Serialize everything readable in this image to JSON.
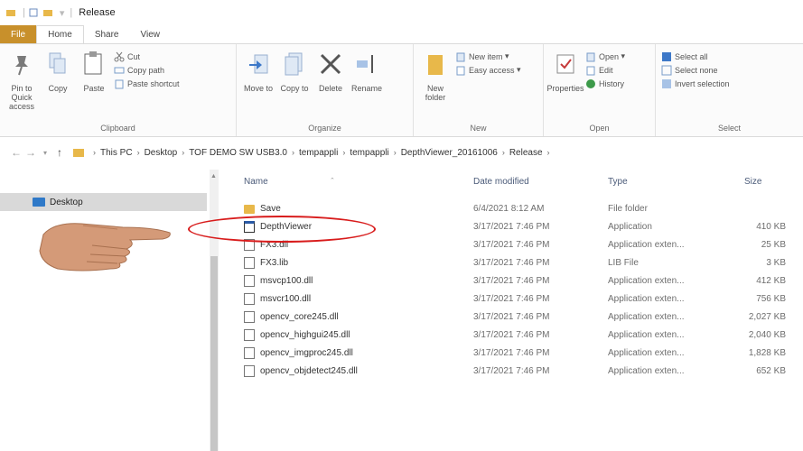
{
  "window": {
    "title": "Release"
  },
  "tabs": [
    {
      "label": "File"
    },
    {
      "label": "Home"
    },
    {
      "label": "Share"
    },
    {
      "label": "View"
    }
  ],
  "ribbon": {
    "clipboard": {
      "label": "Clipboard",
      "pin": "Pin to Quick access",
      "copy": "Copy",
      "paste": "Paste",
      "cut": "Cut",
      "copy_path": "Copy path",
      "paste_shortcut": "Paste shortcut"
    },
    "organize": {
      "label": "Organize",
      "move_to": "Move to",
      "copy_to": "Copy to",
      "delete": "Delete",
      "rename": "Rename"
    },
    "new": {
      "label": "New",
      "new_folder": "New folder",
      "new_item": "New item",
      "easy_access": "Easy access"
    },
    "open": {
      "label": "Open",
      "properties": "Properties",
      "open": "Open",
      "edit": "Edit",
      "history": "History"
    },
    "select": {
      "label": "Select",
      "select_all": "Select all",
      "select_none": "Select none",
      "invert_selection": "Invert selection"
    }
  },
  "address": {
    "crumbs": [
      "This PC",
      "Desktop",
      "TOF DEMO SW USB3.0",
      "tempappli",
      "tempappli",
      "DepthViewer_20161006",
      "Release"
    ]
  },
  "navpane": {
    "desktop": "Desktop"
  },
  "columns": {
    "name": "Name",
    "date": "Date modified",
    "type": "Type",
    "size": "Size"
  },
  "files": [
    {
      "name": "Save",
      "date": "6/4/2021 8:12 AM",
      "type": "File folder",
      "size": "",
      "icon": "folder"
    },
    {
      "name": "DepthViewer",
      "date": "3/17/2021 7:46 PM",
      "type": "Application",
      "size": "410 KB",
      "icon": "app"
    },
    {
      "name": "FX3.dll",
      "date": "3/17/2021 7:46 PM",
      "type": "Application exten...",
      "size": "25 KB",
      "icon": "doc"
    },
    {
      "name": "FX3.lib",
      "date": "3/17/2021 7:46 PM",
      "type": "LIB File",
      "size": "3 KB",
      "icon": "doc"
    },
    {
      "name": "msvcp100.dll",
      "date": "3/17/2021 7:46 PM",
      "type": "Application exten...",
      "size": "412 KB",
      "icon": "doc"
    },
    {
      "name": "msvcr100.dll",
      "date": "3/17/2021 7:46 PM",
      "type": "Application exten...",
      "size": "756 KB",
      "icon": "doc"
    },
    {
      "name": "opencv_core245.dll",
      "date": "3/17/2021 7:46 PM",
      "type": "Application exten...",
      "size": "2,027 KB",
      "icon": "doc"
    },
    {
      "name": "opencv_highgui245.dll",
      "date": "3/17/2021 7:46 PM",
      "type": "Application exten...",
      "size": "2,040 KB",
      "icon": "doc"
    },
    {
      "name": "opencv_imgproc245.dll",
      "date": "3/17/2021 7:46 PM",
      "type": "Application exten...",
      "size": "1,828 KB",
      "icon": "doc"
    },
    {
      "name": "opencv_objdetect245.dll",
      "date": "3/17/2021 7:46 PM",
      "type": "Application exten...",
      "size": "652 KB",
      "icon": "doc"
    }
  ],
  "colors": {
    "file_tab": "#c8902b",
    "highlight_oval": "#d81c1c",
    "folder": "#e8b84a"
  }
}
